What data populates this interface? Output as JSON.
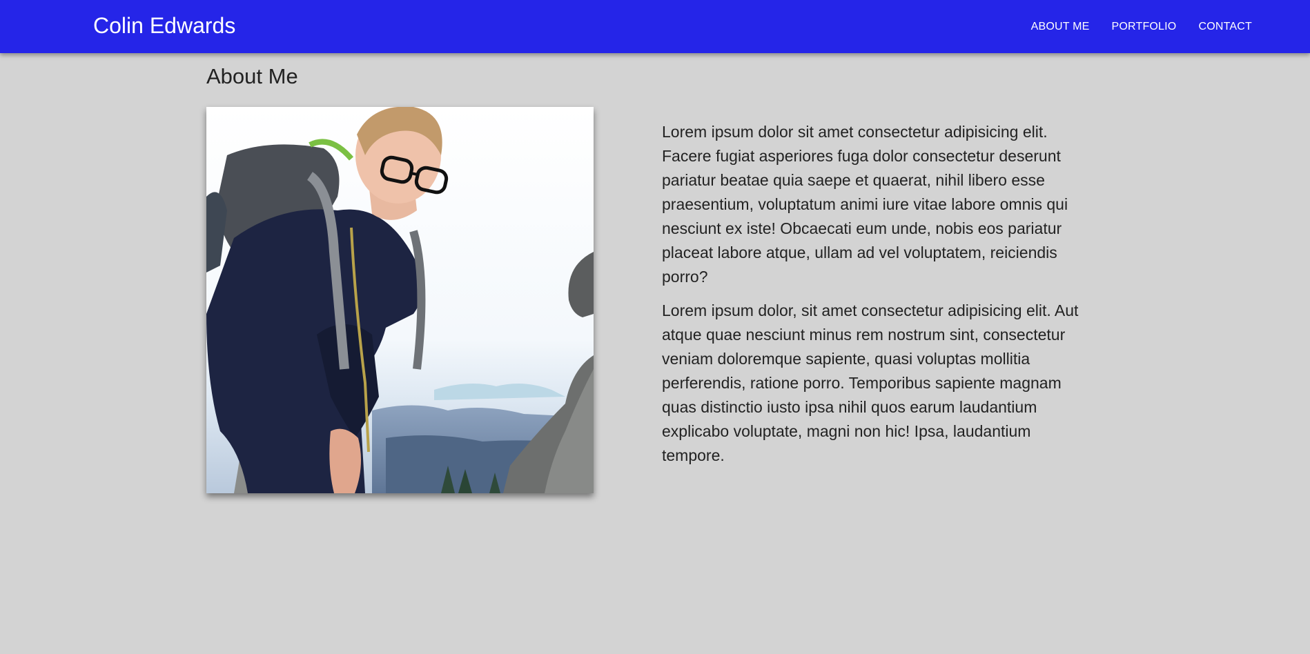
{
  "header": {
    "brand": "Colin Edwards",
    "nav": [
      {
        "label": "ABOUT ME"
      },
      {
        "label": "PORTFOLIO"
      },
      {
        "label": "CONTACT"
      }
    ],
    "background_color": "#2525e8"
  },
  "main": {
    "title": "About Me",
    "photo_description": "photo-of-hiker-with-backpack",
    "paragraphs": [
      "Lorem ipsum dolor sit amet consectetur adipisicing elit. Facere fugiat asperiores fuga dolor consectetur deserunt pariatur beatae quia saepe et quaerat, nihil libero esse praesentium, voluptatum animi iure vitae labore omnis qui nesciunt ex iste! Obcaecati eum unde, nobis eos pariatur placeat labore atque, ullam ad vel voluptatem, reiciendis porro?",
      "Lorem ipsum dolor, sit amet consectetur adipisicing elit. Aut atque quae nesciunt minus rem nostrum sint, consectetur veniam doloremque sapiente, quasi voluptas mollitia perferendis, ratione porro. Temporibus sapiente magnam quas distinctio iusto ipsa nihil quos earum laudantium explicabo voluptate, magni non hic! Ipsa, laudantium tempore."
    ]
  },
  "colors": {
    "page_background": "#d3d3d3",
    "nav_text": "#ffffff"
  }
}
